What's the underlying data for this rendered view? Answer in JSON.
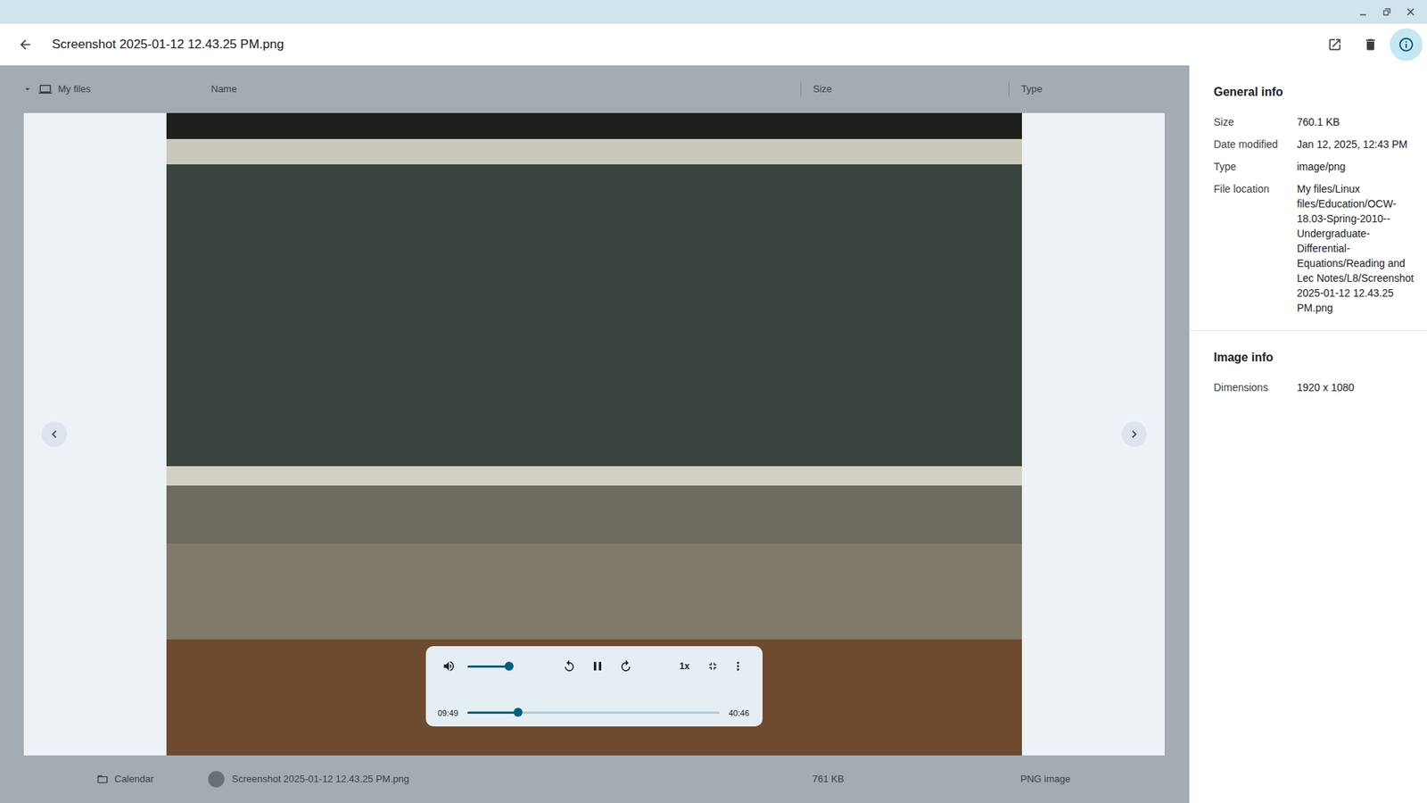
{
  "window": {
    "title": "Screenshot 2025-01-12 12.43.25 PM.png",
    "info_panel_open": true
  },
  "screenshot": {
    "sidebar_top": {
      "label": "My files",
      "expanded": true
    },
    "sidebar_bottom": {
      "label": "Calendar"
    },
    "columns": [
      "Name",
      "Size",
      "Type"
    ],
    "file_row": {
      "name": "Screenshot 2025-01-12 12.43.25 PM.png",
      "size": "761 KB",
      "type": "PNG image"
    },
    "player": {
      "volume": 0.9,
      "playing": true,
      "speed": "1x",
      "position": "09:49",
      "duration": "40:46",
      "progress": 0.2
    }
  },
  "info": {
    "sections": [
      {
        "title": "General info",
        "fields": [
          {
            "label": "Size",
            "value": "760.1 KB"
          },
          {
            "label": "Date modified",
            "value": "Jan 12, 2025, 12:43 PM"
          },
          {
            "label": "Type",
            "value": "image/png"
          },
          {
            "label": "File location",
            "value": "My files/Linux files/Education/OCW-18.03-Spring-2010--Undergraduate-Differential-Equations/Reading and Lec Notes/L8/Screenshot 2025-01-12 12.43.25 PM.png"
          }
        ]
      },
      {
        "title": "Image info",
        "fields": [
          {
            "label": "Dimensions",
            "value": "1920 x 1080"
          }
        ]
      }
    ]
  }
}
